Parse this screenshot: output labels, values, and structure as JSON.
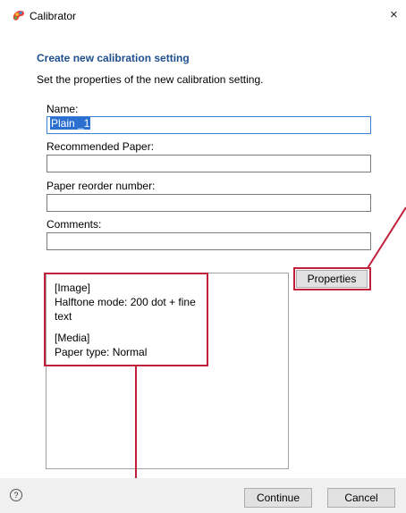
{
  "window": {
    "title": "Calibrator",
    "app_icon": "color-palette-icon",
    "close_label": "×"
  },
  "dialog": {
    "heading": "Create new calibration setting",
    "subheading": "Set the properties of the new calibration setting."
  },
  "fields": {
    "name": {
      "label": "Name:",
      "value": "Plain _1"
    },
    "recommended_paper": {
      "label": "Recommended Paper:",
      "value": ""
    },
    "paper_reorder_number": {
      "label": "Paper reorder number:",
      "value": ""
    },
    "comments": {
      "label": "Comments:",
      "value": ""
    }
  },
  "info": {
    "lines": [
      "[Image]",
      " Halftone mode: 200 dot + fine",
      "text",
      "",
      "[Media]",
      " Paper type: Normal"
    ]
  },
  "properties_button": "Properties",
  "footer": {
    "help_icon": "help-circle-icon",
    "continue_label": "Continue",
    "cancel_label": "Cancel"
  },
  "colors": {
    "heading": "#1f4e8c",
    "annotation": "#c0203a",
    "selection": "#2b6fd1",
    "footer_bg": "#f0f0f0"
  }
}
